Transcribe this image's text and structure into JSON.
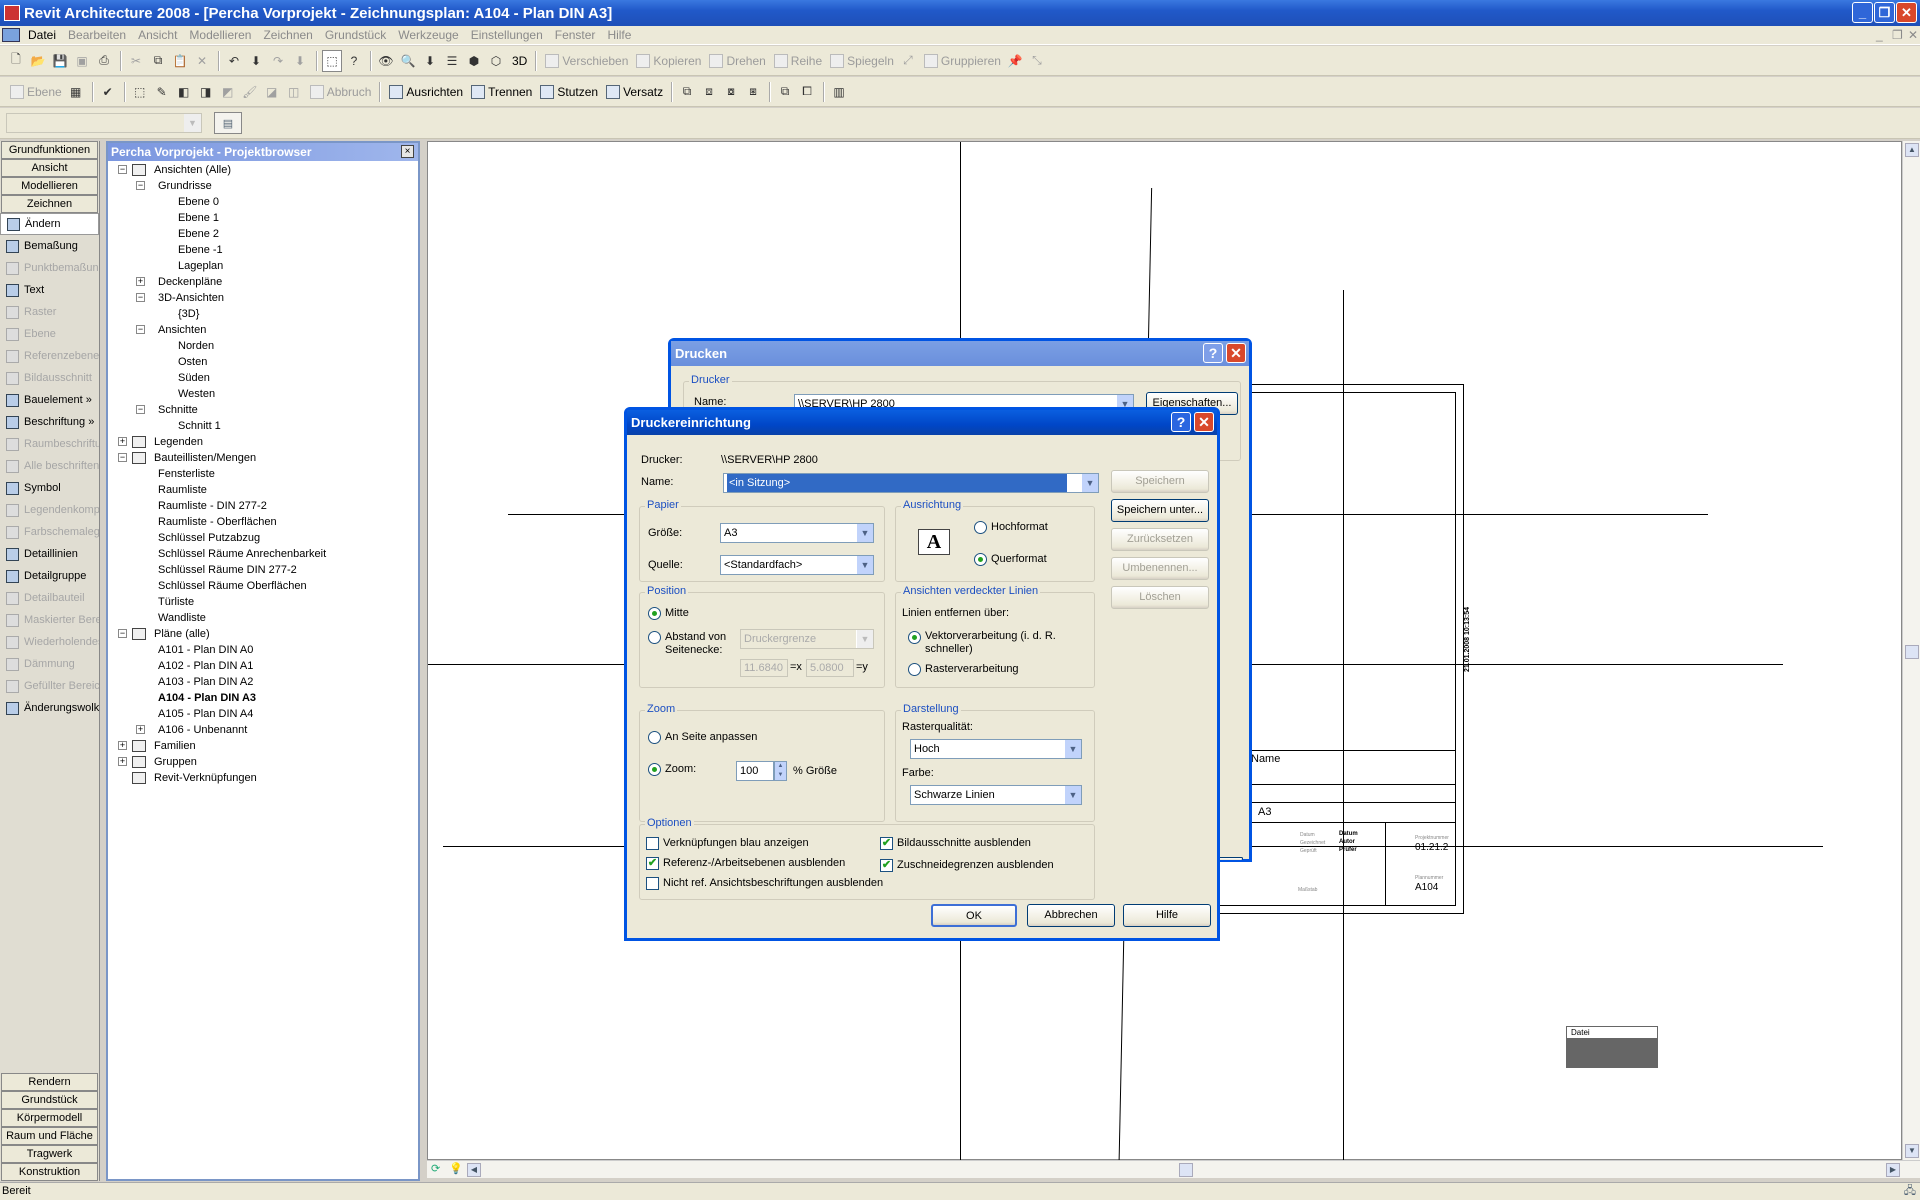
{
  "app": {
    "title": "Revit Architecture 2008 - [Percha Vorprojekt - Zeichnungsplan: A104 - Plan DIN A3]",
    "status": "Bereit"
  },
  "menu": [
    "Datei",
    "Bearbeiten",
    "Ansicht",
    "Modellieren",
    "Zeichnen",
    "Grundstück",
    "Werkzeuge",
    "Einstellungen",
    "Fenster",
    "Hilfe"
  ],
  "toolbar1": {
    "three_d": "3D",
    "verschieben": "Verschieben",
    "kopieren": "Kopieren",
    "drehen": "Drehen",
    "reihe": "Reihe",
    "spiegeln": "Spiegeln",
    "gruppieren": "Gruppieren"
  },
  "toolbar2": {
    "ebene": "Ebene",
    "abbruch": "Abbruch",
    "ausrichten": "Ausrichten",
    "trennen": "Trennen",
    "stutzen": "Stutzen",
    "versatz": "Versatz"
  },
  "designbar": {
    "top_tabs": [
      "Grundfunktionen",
      "Ansicht",
      "Modellieren",
      "Zeichnen"
    ],
    "items": [
      {
        "label": "Ändern",
        "enabled": true
      },
      {
        "label": "Bemaßung",
        "enabled": true
      },
      {
        "label": "Punktbemaßung",
        "enabled": false
      },
      {
        "label": "Text",
        "enabled": true
      },
      {
        "label": "Raster",
        "enabled": false
      },
      {
        "label": "Ebene",
        "enabled": false
      },
      {
        "label": "Referenzebene",
        "enabled": false
      },
      {
        "label": "Bildausschnitt",
        "enabled": false
      },
      {
        "label": "Bauelement »",
        "enabled": true
      },
      {
        "label": "Beschriftung »",
        "enabled": true
      },
      {
        "label": "Raumbeschriftung",
        "enabled": false
      },
      {
        "label": "Alle beschriften",
        "enabled": false
      },
      {
        "label": "Symbol",
        "enabled": true
      },
      {
        "label": "Legendenkomponente",
        "enabled": false
      },
      {
        "label": "Farbschemalegende",
        "enabled": false
      },
      {
        "label": "Detaillinien",
        "enabled": true
      },
      {
        "label": "Detailgruppe",
        "enabled": true
      },
      {
        "label": "Detailbauteil",
        "enabled": false
      },
      {
        "label": "Maskierter Bereich",
        "enabled": false
      },
      {
        "label": "Wiederholendes Detail",
        "enabled": false
      },
      {
        "label": "Dämmung",
        "enabled": false
      },
      {
        "label": "Gefüllter Bereich",
        "enabled": false
      },
      {
        "label": "Änderungswolke",
        "enabled": true
      }
    ],
    "bottom_tabs": [
      "Rendern",
      "Grundstück",
      "Körpermodell",
      "Raum und Fläche",
      "Tragwerk",
      "Konstruktion"
    ]
  },
  "browser": {
    "title": "Percha Vorprojekt - Projektbrowser",
    "close": "×",
    "tree": [
      {
        "label": "Ansichten (Alle)",
        "level": 0,
        "pm": "−",
        "icon": "eye"
      },
      {
        "label": "Grundrisse",
        "level": 1,
        "pm": "−"
      },
      {
        "label": "Ebene 0",
        "level": 2
      },
      {
        "label": "Ebene 1",
        "level": 2
      },
      {
        "label": "Ebene 2",
        "level": 2
      },
      {
        "label": "Ebene -1",
        "level": 2
      },
      {
        "label": "Lageplan",
        "level": 2
      },
      {
        "label": "Deckenpläne",
        "level": 1,
        "pm": "+"
      },
      {
        "label": "3D-Ansichten",
        "level": 1,
        "pm": "−"
      },
      {
        "label": "{3D}",
        "level": 2
      },
      {
        "label": "Ansichten",
        "level": 1,
        "pm": "−"
      },
      {
        "label": "Norden",
        "level": 2
      },
      {
        "label": "Osten",
        "level": 2
      },
      {
        "label": "Süden",
        "level": 2
      },
      {
        "label": "Westen",
        "level": 2
      },
      {
        "label": "Schnitte",
        "level": 1,
        "pm": "−"
      },
      {
        "label": "Schnitt 1",
        "level": 2
      },
      {
        "label": "Legenden",
        "level": 0,
        "pm": "+",
        "icon": "legend"
      },
      {
        "label": "Bauteillisten/Mengen",
        "level": 0,
        "pm": "−",
        "icon": "table"
      },
      {
        "label": "Fensterliste",
        "level": 1
      },
      {
        "label": "Raumliste",
        "level": 1
      },
      {
        "label": "Raumliste - DIN 277-2",
        "level": 1
      },
      {
        "label": "Raumliste - Oberflächen",
        "level": 1
      },
      {
        "label": "Schlüssel Putzabzug",
        "level": 1
      },
      {
        "label": "Schlüssel Räume Anrechenbarkeit",
        "level": 1
      },
      {
        "label": "Schlüssel Räume DIN 277-2",
        "level": 1
      },
      {
        "label": "Schlüssel Räume Oberflächen",
        "level": 1
      },
      {
        "label": "Türliste",
        "level": 1
      },
      {
        "label": "Wandliste",
        "level": 1
      },
      {
        "label": "Pläne (alle)",
        "level": 0,
        "pm": "−",
        "icon": "sheet"
      },
      {
        "label": "A101 - Plan DIN A0",
        "level": 1
      },
      {
        "label": "A102 - Plan DIN A1",
        "level": 1
      },
      {
        "label": "A103 - Plan DIN A2",
        "level": 1
      },
      {
        "label": "A104 - Plan DIN A3",
        "level": 1,
        "bold": true
      },
      {
        "label": "A105 - Plan DIN A4",
        "level": 1
      },
      {
        "label": "A106 - Unbenannt",
        "level": 1,
        "pm": "+"
      },
      {
        "label": "Familien",
        "level": 0,
        "pm": "+",
        "icon": "family"
      },
      {
        "label": "Gruppen",
        "level": 0,
        "pm": "+",
        "icon": "group"
      },
      {
        "label": "Revit-Verknüpfungen",
        "level": 0,
        "icon": "link"
      }
    ]
  },
  "sheet": {
    "name_label": "Name",
    "format": "A3",
    "date_stamp": "21.01.2008 10:13:54",
    "datum_label": "Datum",
    "gezeichnet_label": "Gezeichnet",
    "geprueft_label": "Geprüft",
    "datum_value": "Datum",
    "gezeichnet_value": "Autor",
    "geprueft_value": "Prüfer",
    "projekt_label": "Projektnummer",
    "projekt_value": "01.21.2",
    "plan_label": "Plannummer",
    "plan_value": "A104",
    "massstab_label": "Maßstab",
    "datei_label": "Datei"
  },
  "print_dialog": {
    "title": "Drucken",
    "group": "Drucker",
    "name_label": "Name:",
    "printer": "\\\\SERVER\\HP 2800",
    "properties_btn": "Eigenschaften..."
  },
  "setup_dialog": {
    "title": "Druckereinrichtung",
    "printer_label": "Drucker:",
    "printer_value": "\\\\SERVER\\HP 2800",
    "name_label": "Name:",
    "name_value": "<in Sitzung>",
    "paper": {
      "title": "Papier",
      "size_label": "Größe:",
      "size_value": "A3",
      "source_label": "Quelle:",
      "source_value": "<Standardfach>"
    },
    "orientation": {
      "title": "Ausrichtung",
      "portrait": "Hochformat",
      "landscape": "Querformat",
      "selected": "landscape"
    },
    "position": {
      "title": "Position",
      "center": "Mitte",
      "offset": "Abstand von Seitenecke:",
      "offset_combo": "Druckergrenze",
      "x_value": "11.6840",
      "x_unit": "=x",
      "y_value": "5.0800",
      "y_unit": "=y",
      "selected": "center"
    },
    "hidden_lines": {
      "title": "Ansichten verdeckter Linien",
      "remove_label": "Linien entfernen über:",
      "vector": "Vektorverarbeitung (i. d. R. schneller)",
      "raster": "Rasterverarbeitung",
      "selected": "vector"
    },
    "zoom": {
      "title": "Zoom",
      "fit": "An Seite anpassen",
      "zoom_label": "Zoom:",
      "zoom_value": "100",
      "zoom_unit": "% Größe",
      "selected": "zoom"
    },
    "appearance": {
      "title": "Darstellung",
      "quality_label": "Rasterqualität:",
      "quality_value": "Hoch",
      "color_label": "Farbe:",
      "color_value": "Schwarze Linien"
    },
    "options": {
      "title": "Optionen",
      "opt1": "Verknüpfungen blau anzeigen",
      "opt1_checked": false,
      "opt2": "Referenz-/Arbeitsebenen ausblenden",
      "opt2_checked": true,
      "opt3": "Nicht ref. Ansichtsbeschriftungen ausblenden",
      "opt3_checked": false,
      "opt4": "Bildausschnitte ausblenden",
      "opt4_checked": true,
      "opt5": "Zuschneidegrenzen ausblenden",
      "opt5_checked": true
    },
    "side_buttons": {
      "save": "Speichern",
      "save_as": "Speichern unter...",
      "reset": "Zurücksetzen",
      "rename": "Umbenennen...",
      "delete": "Löschen"
    },
    "ok": "OK",
    "cancel": "Abbrechen",
    "help": "Hilfe"
  },
  "colors": {
    "titlebar": "#0a5fe0",
    "dialog_bg": "#ece9d8",
    "group_label": "#1c4fc2"
  }
}
